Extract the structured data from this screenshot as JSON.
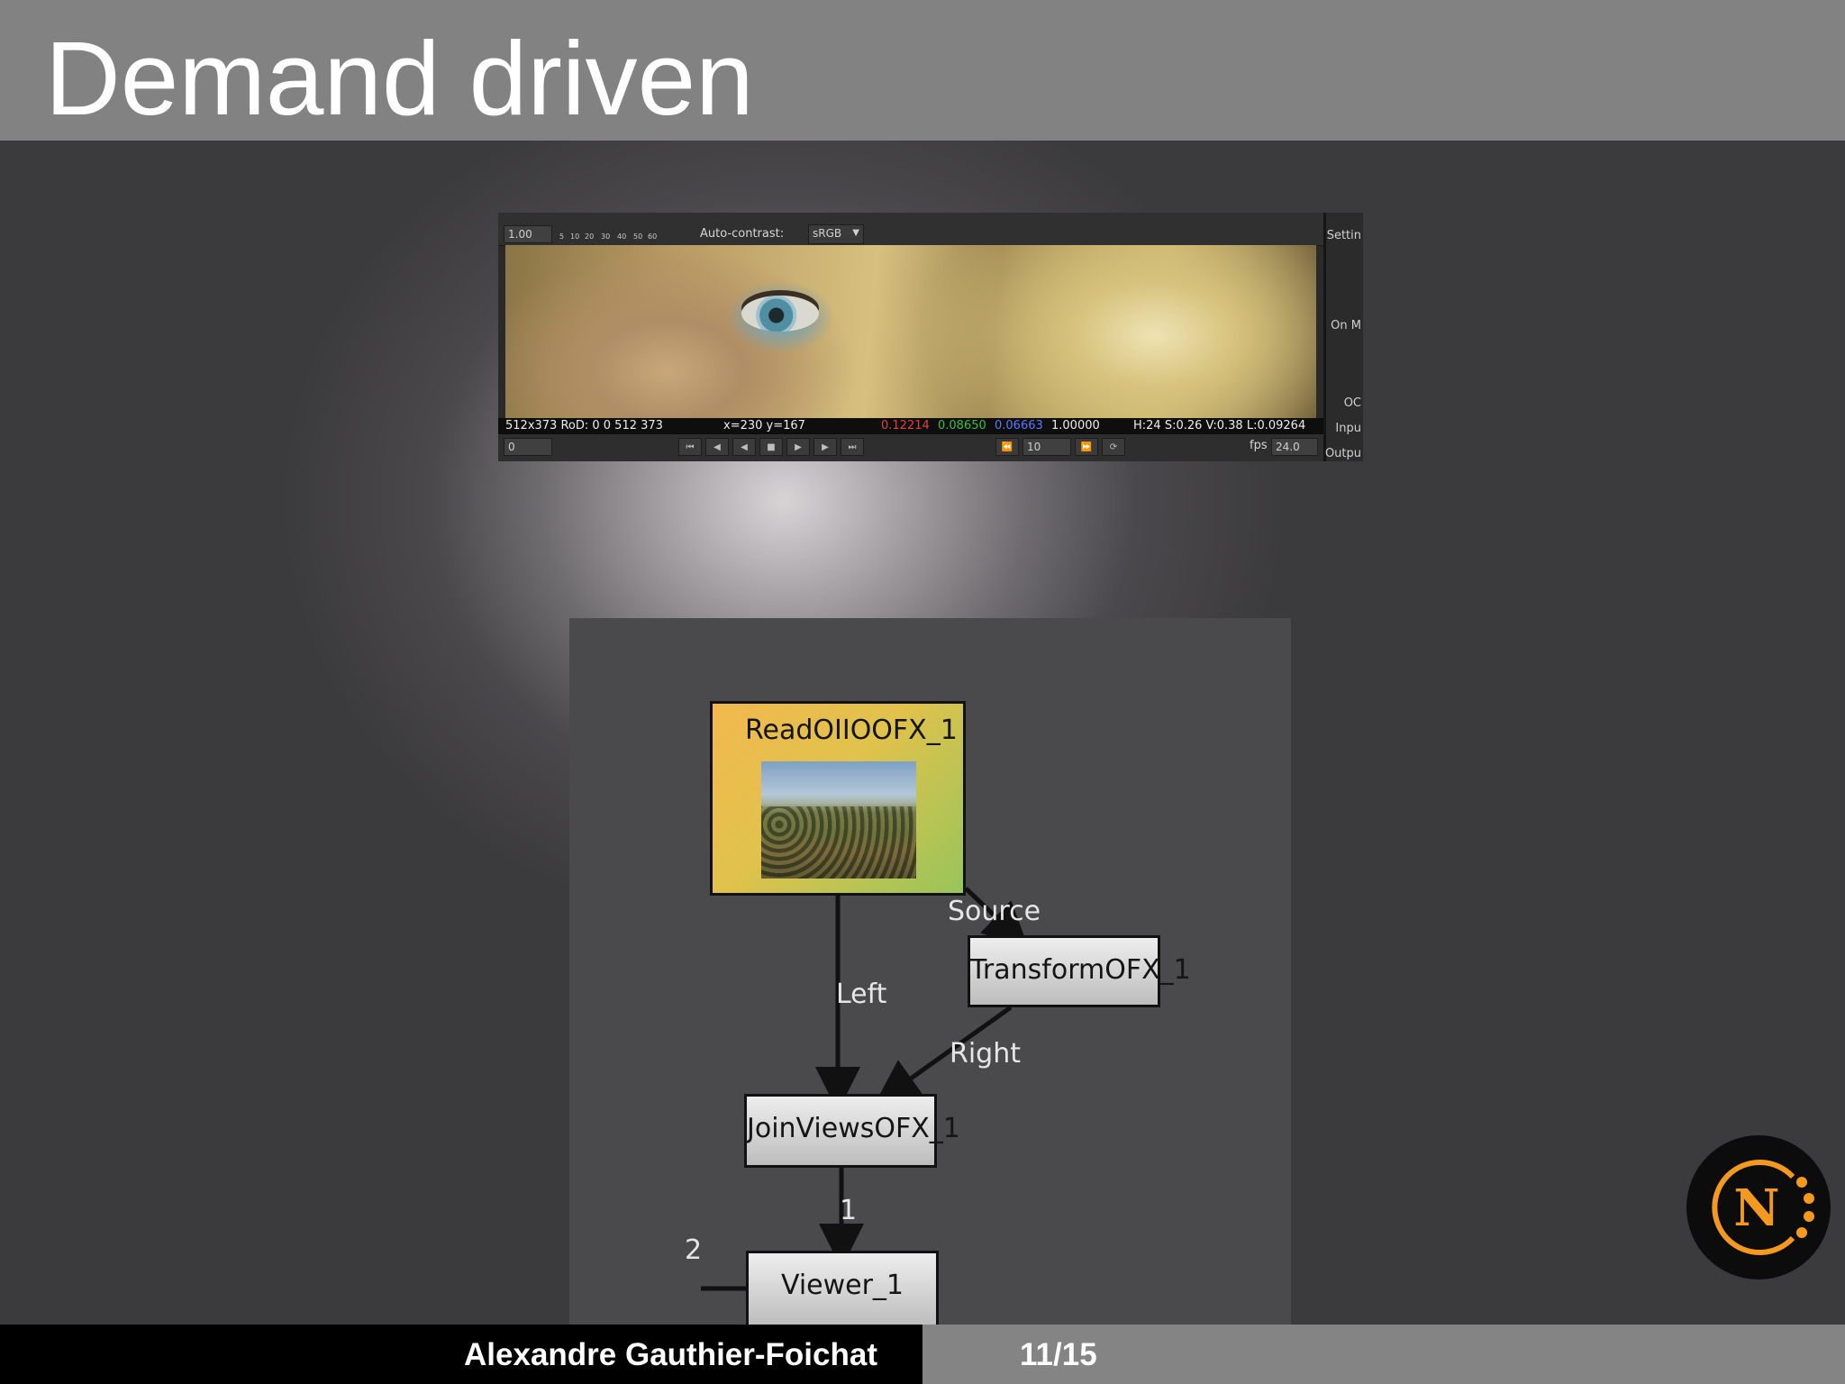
{
  "slide": {
    "title": "Demand driven",
    "author": "Alexandre Gauthier-Foichat",
    "page": "11/15"
  },
  "viewer": {
    "gain_value": "1.00",
    "ruler_ticks": [
      "5",
      "10",
      "20",
      "30",
      "40",
      "50",
      "60"
    ],
    "auto_contrast_label": "Auto-contrast:",
    "colorspace": "sRGB",
    "status": {
      "resolution": "512x373 RoD: 0 0 512 373",
      "coords": "x=230 y=167",
      "r": "0.12214",
      "g": "0.08650",
      "b": "0.06663",
      "a": "1.00000",
      "hsv": "H:24 S:0.26 V:0.38 L:0.09264"
    },
    "frame_value": "0",
    "increment_value": "10",
    "fps_label": "fps",
    "fps_value": "24.0",
    "side_labels": [
      "Settin",
      "On M",
      "OC",
      "Inpu",
      "Outpu"
    ],
    "colors": {
      "red": "#e04040",
      "green": "#38c23a",
      "blue": "#5a78ff"
    }
  },
  "graph": {
    "read_node": "ReadOIIOOFX_1",
    "transform_node": "TransformOFX_1",
    "join_node": "JoinViewsOFX_1",
    "viewer_node": "Viewer_1",
    "edge_source": "Source",
    "edge_left": "Left",
    "edge_right": "Right",
    "edge_input1": "1",
    "edge_input2": "2"
  },
  "logo": {
    "letter": "N",
    "accent": "#f39a1e"
  }
}
